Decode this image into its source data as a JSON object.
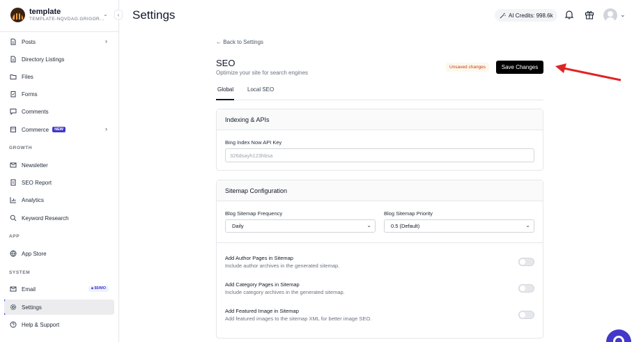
{
  "workspace": {
    "name": "template",
    "slug": "TEMPLATE-NQVDAG.GRIGOR..."
  },
  "sidebar": {
    "items": [
      {
        "label": "Posts",
        "icon": "document-icon"
      },
      {
        "label": "Directory Listings",
        "icon": "document-icon"
      },
      {
        "label": "Files",
        "icon": "folder-icon"
      },
      {
        "label": "Forms",
        "icon": "clipboard-icon"
      },
      {
        "label": "Comments",
        "icon": "comment-icon"
      },
      {
        "label": "Commerce",
        "icon": "box-icon",
        "badge": "NEW"
      }
    ],
    "growth_label": "GROWTH",
    "growth_items": [
      {
        "label": "Newsletter",
        "icon": "mail-icon"
      },
      {
        "label": "SEO Report",
        "icon": "report-icon"
      },
      {
        "label": "Analytics",
        "icon": "chart-icon"
      },
      {
        "label": "Keyword Research",
        "icon": "search-icon"
      }
    ],
    "app_label": "APP",
    "app_items": [
      {
        "label": "App Store",
        "icon": "globe-icon"
      }
    ],
    "system_label": "SYSTEM",
    "system_items": [
      {
        "label": "Email",
        "icon": "mail-icon",
        "badge": "$5/MO"
      },
      {
        "label": "Settings",
        "icon": "gear-icon"
      },
      {
        "label": "Help & Support",
        "icon": "help-icon"
      }
    ]
  },
  "header": {
    "title": "Settings",
    "credits": "AI Credits: 998.6k"
  },
  "content": {
    "back_link": "← Back to Settings",
    "title": "SEO",
    "subtitle": "Optimize your site for search engines",
    "unsaved": "Unsaved changes",
    "save_label": "Save Changes",
    "tabs": [
      "Global",
      "Local SEO"
    ],
    "indexing": {
      "header": "Indexing & APIs",
      "key_label": "Bing Index Now API Key",
      "key_value": "326dsayh123hbsa"
    },
    "sitemap": {
      "header": "Sitemap Configuration",
      "freq_label": "Blog Sitemap Frequency",
      "freq_value": "Daily",
      "prio_label": "Blog Sitemap Priority",
      "prio_value": "0.5 (Default)",
      "options": [
        {
          "title": "Add Author Pages in Sitemap",
          "desc": "Include author archives in the generated sitemap.",
          "enabled": false
        },
        {
          "title": "Add Category Pages in Sitemap",
          "desc": "Include category archives in the generated sitemap.",
          "enabled": false
        },
        {
          "title": "Add Featured Image in Sitemap",
          "desc": "Add featured images to the sitemap XML for better image SEO.",
          "enabled": false
        }
      ]
    }
  },
  "colors": {
    "accent": "#4338ca",
    "arrow": "#e02424",
    "save_button": "#000000"
  }
}
